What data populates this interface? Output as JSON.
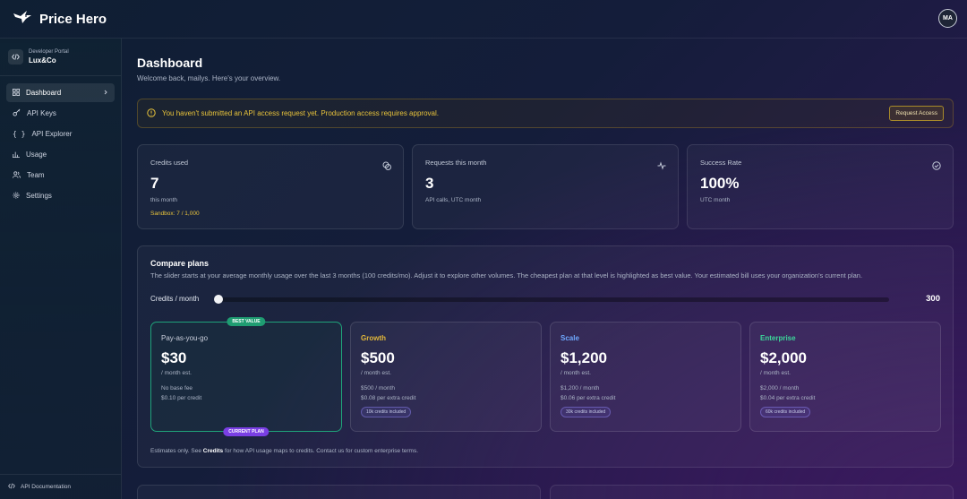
{
  "app": {
    "brand": "Price Hero",
    "avatar_initials": "MA"
  },
  "sidebar": {
    "org_label": "Developer Portal",
    "org_name": "Lux&Co",
    "items": [
      {
        "label": "Dashboard",
        "icon": "dashboard-icon",
        "active": true
      },
      {
        "label": "API Keys",
        "icon": "key-icon"
      },
      {
        "label": "API Explorer",
        "icon": "braces-icon"
      },
      {
        "label": "Usage",
        "icon": "bar-chart-icon"
      },
      {
        "label": "Team",
        "icon": "users-icon"
      },
      {
        "label": "Settings",
        "icon": "gear-icon"
      }
    ],
    "footer": "API Documentation"
  },
  "page": {
    "title": "Dashboard",
    "subtitle": "Welcome back, mailys. Here's your overview."
  },
  "alert": {
    "message": "You haven't submitted an API access request yet. Production access requires approval.",
    "button": "Request Access"
  },
  "stats": [
    {
      "label": "Credits used",
      "value": "7",
      "note": "this month",
      "extra": "Sandbox: 7 / 1,000",
      "icon": "coins-icon"
    },
    {
      "label": "Requests this month",
      "value": "3",
      "note": "API calls, UTC month",
      "icon": "activity-icon"
    },
    {
      "label": "Success Rate",
      "value": "100%",
      "note": "UTC month",
      "icon": "check-circle-icon"
    }
  ],
  "compare": {
    "title": "Compare plans",
    "description": "The slider starts at your average monthly usage over the last 3 months (100 credits/mo). Adjust it to explore other volumes. The cheapest plan at that level is highlighted as best value. Your estimated bill uses your organization's current plan.",
    "slider_label": "Credits / month",
    "slider_value": "300",
    "slider_fraction": 0.0,
    "plans": [
      {
        "name": "Pay-as-you-go",
        "price": "$30",
        "est": "/ month est.",
        "line1": "No base fee",
        "line2": "$0.10 per credit",
        "best_badge": "BEST VALUE",
        "current_badge": "CURRENT PLAN",
        "color": "#c9cedb"
      },
      {
        "name": "Growth",
        "price": "$500",
        "est": "/ month est.",
        "line1": "$500 / month",
        "line2": "$0.08 per extra credit",
        "chip": "10k credits included",
        "color": "#e2b73a"
      },
      {
        "name": "Scale",
        "price": "$1,200",
        "est": "/ month est.",
        "line1": "$1,200 / month",
        "line2": "$0.06 per extra credit",
        "chip": "30k credits included",
        "color": "#6ea8ff"
      },
      {
        "name": "Enterprise",
        "price": "$2,000",
        "est": "/ month est.",
        "line1": "$2,000 / month",
        "line2": "$0.04 per extra credit",
        "chip": "60k credits included",
        "color": "#3dd69a"
      }
    ],
    "footer_prefix": "Estimates only. See ",
    "footer_link": "Credits",
    "footer_suffix": " for how API usage maps to credits. Contact us for custom enterprise terms."
  }
}
